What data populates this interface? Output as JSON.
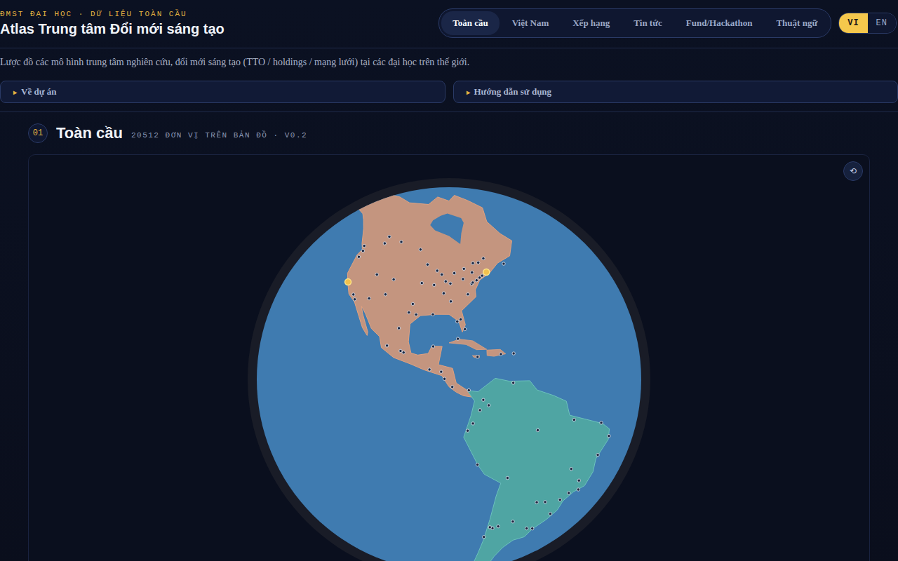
{
  "header": {
    "kicker": "ĐMST ĐẠI HỌC · DỮ LIỆU TOÀN CẦU",
    "title": "Atlas Trung tâm Đổi mới sáng tạo"
  },
  "tabs": [
    {
      "label": "Toàn cầu",
      "selected": true
    },
    {
      "label": "Việt Nam",
      "selected": false
    },
    {
      "label": "Xếp hạng",
      "selected": false
    },
    {
      "label": "Tin tức",
      "selected": false
    },
    {
      "label": "Fund/Hackathon",
      "selected": false
    },
    {
      "label": "Thuật ngữ",
      "selected": false
    }
  ],
  "languages": [
    {
      "label": "VI",
      "selected": true
    },
    {
      "label": "EN",
      "selected": false
    }
  ],
  "subtitle": "Lược đồ các mô hình trung tâm nghiên cứu, đổi mới sáng tạo (TTO / holdings / mạng lưới) tại các đại học trên thế giới.",
  "collapsibles": [
    {
      "icon": "▸",
      "label": "Về dự án",
      "expanded": false
    },
    {
      "icon": "▸",
      "label": "Hướng dẫn sử dụng",
      "expanded": false
    }
  ],
  "section": {
    "number": "01",
    "title": "Toàn cầu",
    "meta": "20512 ĐƠN VỊ TRÊN BẢN ĐỒ · V0.2"
  },
  "map": {
    "reset_icon": "⟲",
    "markers": [
      {
        "lon": -122.17,
        "lat": 37.43,
        "highlight": true
      },
      {
        "lon": -71.09,
        "lat": 42.36,
        "highlight": true
      },
      {
        "lon": -118.24,
        "lat": 34.05,
        "highlight": false
      },
      {
        "lon": -117.16,
        "lat": 32.72,
        "highlight": false
      },
      {
        "lon": -122.33,
        "lat": 47.61,
        "highlight": false
      },
      {
        "lon": -122.68,
        "lat": 45.52,
        "highlight": false
      },
      {
        "lon": -111.89,
        "lat": 40.76,
        "highlight": false
      },
      {
        "lon": -104.99,
        "lat": 39.74,
        "highlight": false
      },
      {
        "lon": -112.07,
        "lat": 33.45,
        "highlight": false
      },
      {
        "lon": -106.65,
        "lat": 35.08,
        "highlight": false
      },
      {
        "lon": -97.74,
        "lat": 30.27,
        "highlight": false
      },
      {
        "lon": -95.37,
        "lat": 29.76,
        "highlight": false
      },
      {
        "lon": -96.8,
        "lat": 32.78,
        "highlight": false
      },
      {
        "lon": -90.07,
        "lat": 29.95,
        "highlight": false
      },
      {
        "lon": -84.39,
        "lat": 33.75,
        "highlight": false
      },
      {
        "lon": -80.19,
        "lat": 25.76,
        "highlight": false
      },
      {
        "lon": -82.46,
        "lat": 27.95,
        "highlight": false
      },
      {
        "lon": -81.38,
        "lat": 28.54,
        "highlight": false
      },
      {
        "lon": -78.64,
        "lat": 35.78,
        "highlight": false
      },
      {
        "lon": -77.04,
        "lat": 38.9,
        "highlight": false
      },
      {
        "lon": -75.16,
        "lat": 39.95,
        "highlight": false
      },
      {
        "lon": -73.94,
        "lat": 40.73,
        "highlight": false
      },
      {
        "lon": -76.61,
        "lat": 39.29,
        "highlight": false
      },
      {
        "lon": -79.99,
        "lat": 40.44,
        "highlight": false
      },
      {
        "lon": -83.05,
        "lat": 42.33,
        "highlight": false
      },
      {
        "lon": -87.63,
        "lat": 41.88,
        "highlight": false
      },
      {
        "lon": -89.4,
        "lat": 43.07,
        "highlight": false
      },
      {
        "lon": -93.27,
        "lat": 44.98,
        "highlight": false
      },
      {
        "lon": -90.2,
        "lat": 38.63,
        "highlight": false
      },
      {
        "lon": -94.58,
        "lat": 39.1,
        "highlight": false
      },
      {
        "lon": -86.16,
        "lat": 39.77,
        "highlight": false
      },
      {
        "lon": -84.51,
        "lat": 39.1,
        "highlight": false
      },
      {
        "lon": -86.78,
        "lat": 36.16,
        "highlight": false
      },
      {
        "lon": -72.92,
        "lat": 41.31,
        "highlight": false
      },
      {
        "lon": -76.5,
        "lat": 42.44,
        "highlight": false
      },
      {
        "lon": -79.38,
        "lat": 43.65,
        "highlight": false
      },
      {
        "lon": -73.57,
        "lat": 45.5,
        "highlight": false
      },
      {
        "lon": -75.7,
        "lat": 45.42,
        "highlight": false
      },
      {
        "lon": -123.12,
        "lat": 49.28,
        "highlight": false
      },
      {
        "lon": -114.07,
        "lat": 51.05,
        "highlight": false
      },
      {
        "lon": -113.49,
        "lat": 53.55,
        "highlight": false
      },
      {
        "lon": -97.14,
        "lat": 49.9,
        "highlight": false
      },
      {
        "lon": -106.67,
        "lat": 52.13,
        "highlight": false
      },
      {
        "lon": -63.57,
        "lat": 44.65,
        "highlight": false
      },
      {
        "lon": -71.21,
        "lat": 46.81,
        "highlight": false
      },
      {
        "lon": -99.13,
        "lat": 19.43,
        "highlight": false
      },
      {
        "lon": -103.35,
        "lat": 20.66,
        "highlight": false
      },
      {
        "lon": -100.31,
        "lat": 25.69,
        "highlight": false
      },
      {
        "lon": -98.2,
        "lat": 19.04,
        "highlight": false
      },
      {
        "lon": -89.62,
        "lat": 20.97,
        "highlight": false
      },
      {
        "lon": -90.51,
        "lat": 14.63,
        "highlight": false
      },
      {
        "lon": -84.09,
        "lat": 9.93,
        "highlight": false
      },
      {
        "lon": -79.52,
        "lat": 8.98,
        "highlight": false
      },
      {
        "lon": -87.2,
        "lat": 14.07,
        "highlight": false
      },
      {
        "lon": -86.25,
        "lat": 12.13,
        "highlight": false
      },
      {
        "lon": -82.37,
        "lat": 23.11,
        "highlight": false
      },
      {
        "lon": -69.93,
        "lat": 18.49,
        "highlight": false
      },
      {
        "lon": -66.1,
        "lat": 18.47,
        "highlight": false
      },
      {
        "lon": -76.79,
        "lat": 18.01,
        "highlight": false
      },
      {
        "lon": -74.07,
        "lat": 4.71,
        "highlight": false
      },
      {
        "lon": -75.56,
        "lat": 6.25,
        "highlight": false
      },
      {
        "lon": -76.53,
        "lat": 3.45,
        "highlight": false
      },
      {
        "lon": -66.9,
        "lat": 10.48,
        "highlight": false
      },
      {
        "lon": -78.47,
        "lat": -0.18,
        "highlight": false
      },
      {
        "lon": -79.9,
        "lat": -2.17,
        "highlight": false
      },
      {
        "lon": -77.04,
        "lat": -12.05,
        "highlight": false
      },
      {
        "lon": -68.15,
        "lat": -16.5,
        "highlight": false
      },
      {
        "lon": -70.67,
        "lat": -33.45,
        "highlight": false
      },
      {
        "lon": -71.6,
        "lat": -33.05,
        "highlight": false
      },
      {
        "lon": -73.05,
        "lat": -36.83,
        "highlight": false
      },
      {
        "lon": -58.38,
        "lat": -34.6,
        "highlight": false
      },
      {
        "lon": -64.18,
        "lat": -31.42,
        "highlight": false
      },
      {
        "lon": -68.84,
        "lat": -32.89,
        "highlight": false
      },
      {
        "lon": -57.55,
        "lat": -25.26,
        "highlight": false
      },
      {
        "lon": -56.16,
        "lat": -34.9,
        "highlight": false
      },
      {
        "lon": -46.63,
        "lat": -23.55,
        "highlight": false
      },
      {
        "lon": -43.17,
        "lat": -22.91,
        "highlight": false
      },
      {
        "lon": -47.88,
        "lat": -15.79,
        "highlight": false
      },
      {
        "lon": -43.94,
        "lat": -19.92,
        "highlight": false
      },
      {
        "lon": -49.27,
        "lat": -25.43,
        "highlight": false
      },
      {
        "lon": -51.23,
        "lat": -30.03,
        "highlight": false
      },
      {
        "lon": -38.5,
        "lat": -12.97,
        "highlight": false
      },
      {
        "lon": -34.88,
        "lat": -8.05,
        "highlight": false
      },
      {
        "lon": -38.54,
        "lat": -3.72,
        "highlight": false
      },
      {
        "lon": -48.5,
        "lat": -1.46,
        "highlight": false
      },
      {
        "lon": -60.02,
        "lat": -3.12,
        "highlight": false
      },
      {
        "lon": -54.6,
        "lat": -25.5,
        "highlight": false
      }
    ]
  }
}
